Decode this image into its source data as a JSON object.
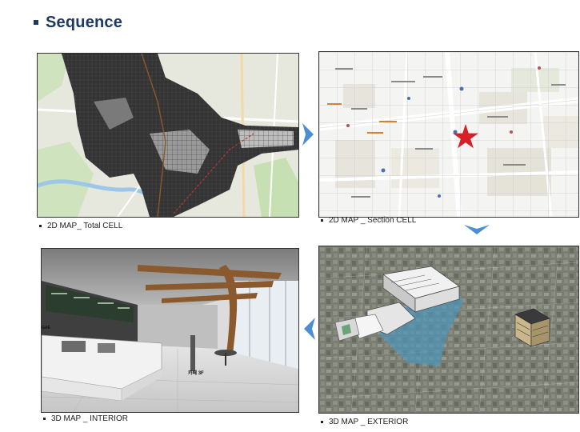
{
  "slide": {
    "title": "Sequence"
  },
  "panels": {
    "total_cell": {
      "caption": "2D MAP_ Total CELL"
    },
    "section_cell": {
      "caption": "2D MAP _ Section CELL"
    },
    "exterior": {
      "caption": "3D MAP _ EXTERIOR"
    },
    "interior": {
      "caption": "3D MAP _ INTERIOR"
    }
  },
  "interior_labels": {
    "left_sign": "GAE",
    "floor_sign": "카페 3F"
  },
  "colors": {
    "title": "#1f3864",
    "arrow": "#4a8fd4",
    "star": "#d61f26"
  }
}
